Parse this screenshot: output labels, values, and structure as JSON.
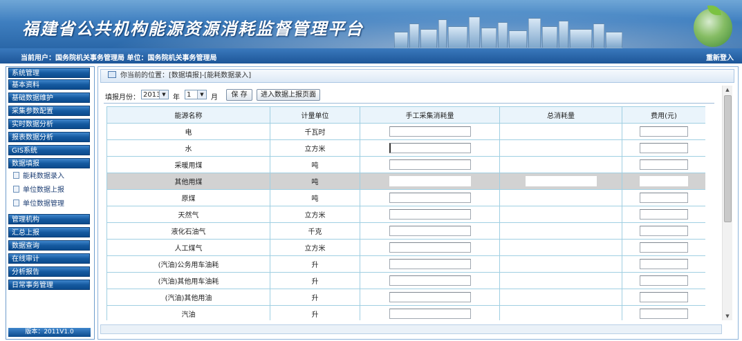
{
  "header": {
    "title": "福建省公共机构能源资源消耗监督管理平台",
    "user_info": "当前用户：国务院机关事务管理局  单位：国务院机关事务管理局",
    "relogin": "重新登入"
  },
  "sidebar": {
    "items": [
      "系统管理",
      "基本资料",
      "基础数据维护",
      "采集参数配置",
      "实时数据分析",
      "报表数据分析",
      "GIS系统",
      "数据填报"
    ],
    "sub_items": [
      "能耗数据录入",
      "单位数据上报",
      "单位数据管理"
    ],
    "items2": [
      "管理机构",
      "汇总上报",
      "数据查询",
      "在线审计",
      "分析报告",
      "日常事务管理"
    ],
    "version": "版本：2011V1.0"
  },
  "breadcrumb": "你当前的位置：[数据填报]-[能耗数据录入]",
  "toolbar": {
    "month_label": "填报月份：",
    "year_value": "2013",
    "year_label": "年",
    "month_value": "1",
    "month_unit": "月",
    "save_label": "保 存",
    "upload_label": "进入数据上报页面"
  },
  "table": {
    "columns": [
      "能源名称",
      "计量单位",
      "手工采集消耗量",
      "总消耗量",
      "费用(元)"
    ],
    "rows": [
      {
        "name": "电",
        "unit": "千瓦时"
      },
      {
        "name": "水",
        "unit": "立方米"
      },
      {
        "name": "采暖用煤",
        "unit": "吨"
      },
      {
        "name": "其他用煤",
        "unit": "吨"
      },
      {
        "name": "原煤",
        "unit": "吨"
      },
      {
        "name": "天然气",
        "unit": "立方米"
      },
      {
        "name": "液化石油气",
        "unit": "千克"
      },
      {
        "name": "人工煤气",
        "unit": "立方米"
      },
      {
        "name": "(汽油)公务用车油耗",
        "unit": "升"
      },
      {
        "name": "(汽油)其他用车油耗",
        "unit": "升"
      },
      {
        "name": "(汽油)其他用油",
        "unit": "升"
      },
      {
        "name": "汽油",
        "unit": "升"
      }
    ]
  },
  "colors": {
    "header_blue": "#2a67a8",
    "menu_blue": "#155aa0",
    "border": "#9fcfe2",
    "highlight_row": "#d2d2d2"
  }
}
